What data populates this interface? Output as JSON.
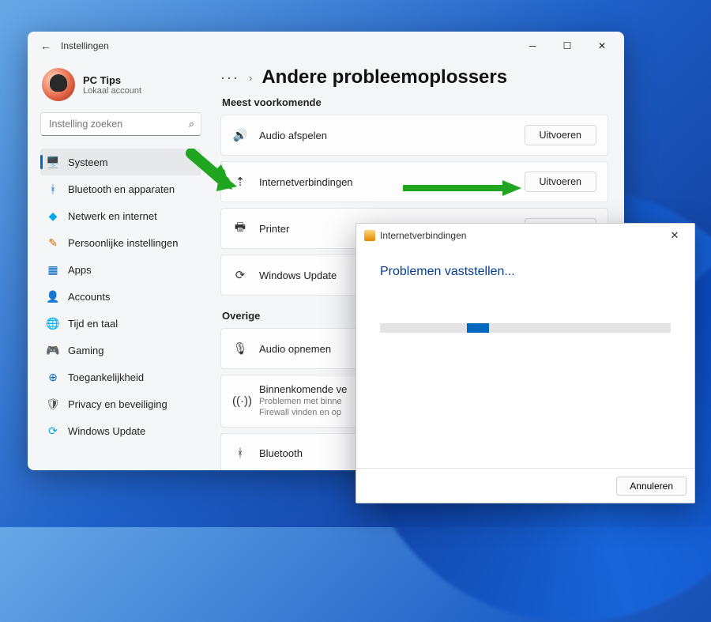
{
  "window": {
    "title": "Instellingen"
  },
  "profile": {
    "name": "PC Tips",
    "sub": "Lokaal account"
  },
  "search": {
    "placeholder": "Instelling zoeken"
  },
  "nav": {
    "items": [
      {
        "icon": "display-icon",
        "label": "Systeem",
        "color": "ico-system",
        "active": true
      },
      {
        "icon": "bluetooth-icon",
        "label": "Bluetooth en apparaten",
        "color": "ico-bt"
      },
      {
        "icon": "wifi-icon",
        "label": "Netwerk en internet",
        "color": "ico-net"
      },
      {
        "icon": "brush-icon",
        "label": "Persoonlijke instellingen",
        "color": "ico-pers"
      },
      {
        "icon": "apps-icon",
        "label": "Apps",
        "color": "ico-apps"
      },
      {
        "icon": "person-icon",
        "label": "Accounts",
        "color": "ico-acc"
      },
      {
        "icon": "globe-icon",
        "label": "Tijd en taal",
        "color": "ico-time"
      },
      {
        "icon": "gamepad-icon",
        "label": "Gaming",
        "color": "ico-game"
      },
      {
        "icon": "accessibility-icon",
        "label": "Toegankelijkheid",
        "color": "ico-access"
      },
      {
        "icon": "shield-icon",
        "label": "Privacy en beveiliging",
        "color": "ico-priv"
      },
      {
        "icon": "sync-icon",
        "label": "Windows Update",
        "color": "ico-wu"
      }
    ]
  },
  "breadcrumb": {
    "dots": "···",
    "title": "Andere probleemoplossers"
  },
  "sections": {
    "most_common": "Meest voorkomende",
    "other": "Overige"
  },
  "run_label": "Uitvoeren",
  "troubleshooters_common": [
    {
      "icon": "speaker-icon",
      "title": "Audio afspelen"
    },
    {
      "icon": "wifi-signal-icon",
      "title": "Internetverbindingen"
    },
    {
      "icon": "printer-icon",
      "title": "Printer"
    },
    {
      "icon": "refresh-icon",
      "title": "Windows Update"
    }
  ],
  "troubleshooters_other": [
    {
      "icon": "microphone-icon",
      "title": "Audio opnemen"
    },
    {
      "icon": "antenna-icon",
      "title": "Binnenkomende ve",
      "sub": "Problemen met binne\nFirewall vinden en op"
    },
    {
      "icon": "bluetooth2-icon",
      "title": "Bluetooth"
    }
  ],
  "dialog": {
    "title": "Internetverbindingen",
    "status": "Problemen vaststellen...",
    "cancel": "Annuleren"
  },
  "colors": {
    "accent": "#0067c0",
    "arrow": "#1fa51f"
  }
}
